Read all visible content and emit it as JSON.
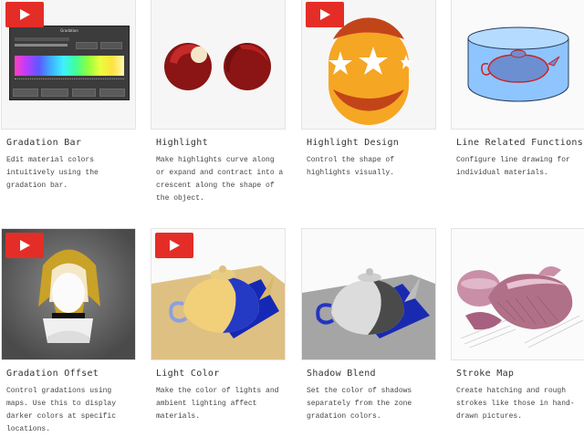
{
  "cards": [
    {
      "title": "Gradation Bar",
      "desc": "Edit material colors intuitively using the gradation bar.",
      "video": true
    },
    {
      "title": "Highlight",
      "desc": "Make highlights curve along or expand and contract into a crescent along the shape of the object.",
      "video": false
    },
    {
      "title": "Highlight Design",
      "desc": "Control the shape of highlights visually.",
      "video": true
    },
    {
      "title": "Line Related Functions",
      "desc": "Configure line drawing for individual materials.",
      "video": false
    },
    {
      "title": "Gradation Offset",
      "desc": "Control gradations using maps. Use this to display darker colors at specific locations.",
      "video": true
    },
    {
      "title": "Light Color",
      "desc": "Make the color of lights and ambient lighting affect materials.",
      "video": true
    },
    {
      "title": "Shadow Blend",
      "desc": "Set the color of shadows separately from the zone gradation colors.",
      "video": false
    },
    {
      "title": "Stroke Map",
      "desc": "Create hatching and rough strokes like those in hand-drawn pictures.",
      "video": false
    }
  ],
  "icons": {
    "video": "play-button-icon"
  },
  "colors": {
    "play": "#e52d27",
    "title": "#333333",
    "desc": "#444444"
  }
}
